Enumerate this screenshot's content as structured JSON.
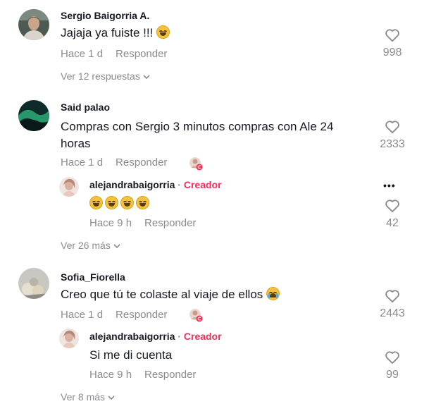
{
  "comments": [
    {
      "username": "Sergio Baigorria A.",
      "text": "Jajaja ya fuiste !!! ",
      "time": "Hace 1 d",
      "reply_label": "Responder",
      "likes": "998",
      "view_more": "Ver 12 respuestas",
      "replies": []
    },
    {
      "username": "Said palao",
      "text_line1": "Compras con Sergio 3 minutos compras con Ale 24",
      "text_line2": "horas",
      "time": "Hace 1 d",
      "reply_label": "Responder",
      "likes": "2333",
      "view_more": "Ver 26 más",
      "replies": [
        {
          "username": "alejandrabaigorria",
          "separator": "·",
          "badge": "Creador",
          "time": "Hace 9 h",
          "reply_label": "Responder",
          "likes": "42",
          "more_options": "•••"
        }
      ]
    },
    {
      "username": "Sofia_Fiorella",
      "text": "Creo que tú te colaste al viaje de ellos ",
      "time": "Hace 1 d",
      "reply_label": "Responder",
      "likes": "2443",
      "view_more": "Ver 8 más",
      "replies": [
        {
          "username": "alejandrabaigorria",
          "separator": "·",
          "badge": "Creador",
          "text": "Si me di cuenta",
          "time": "Hace 9 h",
          "reply_label": "Responder",
          "likes": "99"
        }
      ]
    }
  ],
  "icons": {
    "heart": "heart-outline-icon",
    "chevron": "chevron-down-icon",
    "laughing_emoji": "grinning-sweat-emoji",
    "crying_emoji": "loudly-crying-emoji"
  },
  "colors": {
    "text": "#161823",
    "muted": "#8a8b91",
    "creator": "#fe2c55"
  }
}
